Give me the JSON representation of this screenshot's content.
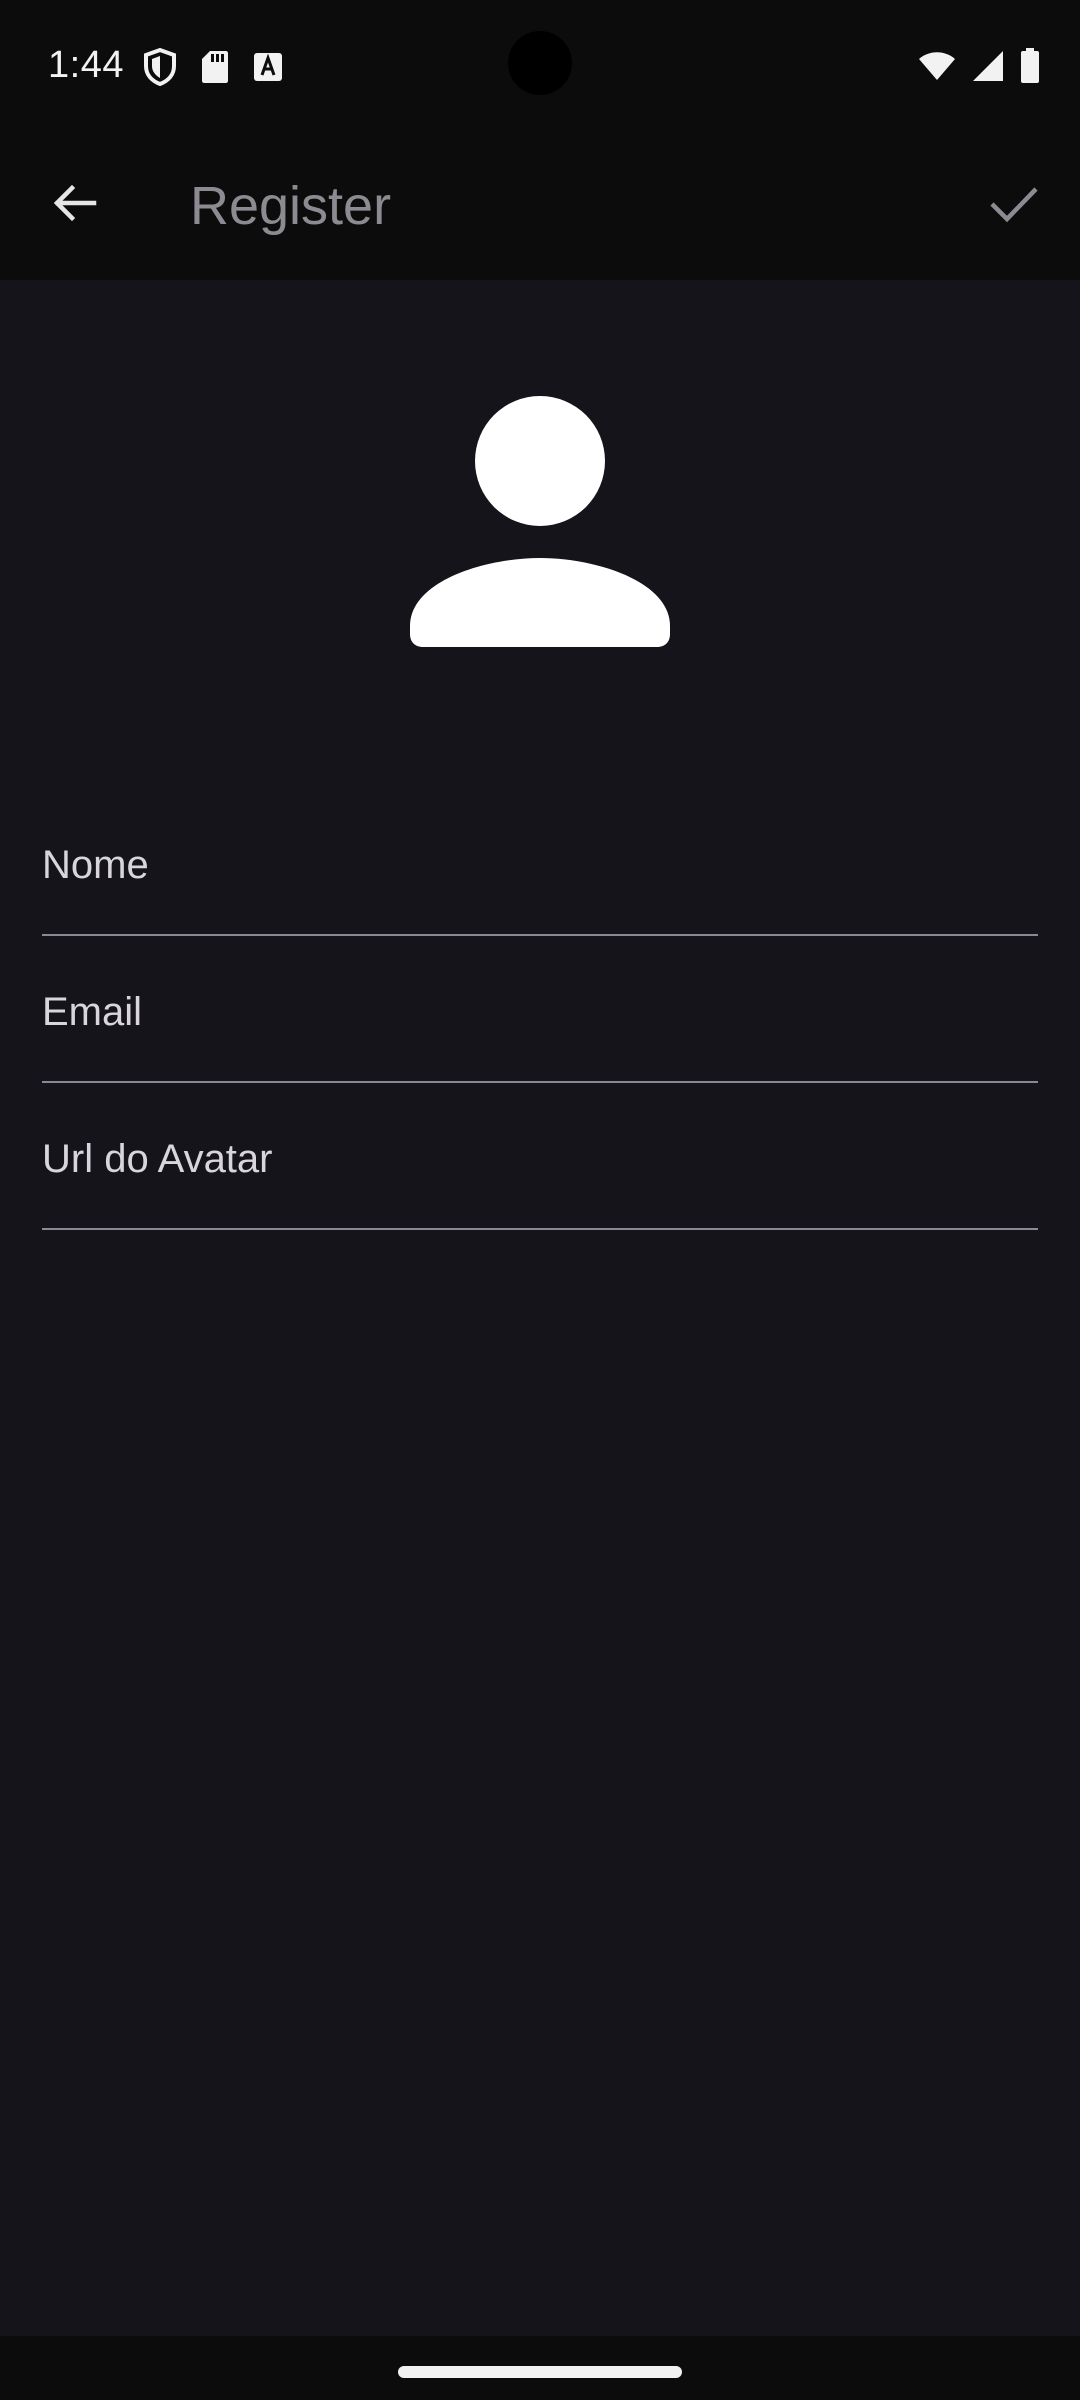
{
  "status_bar": {
    "time": "1:44",
    "left_icons": [
      "shield-icon",
      "sd-card-icon",
      "text-a-icon"
    ],
    "right_icons": [
      "wifi-icon",
      "signal-icon",
      "battery-icon"
    ]
  },
  "app_bar": {
    "title": "Register",
    "back_icon": "arrow-back-icon",
    "confirm_icon": "check-icon"
  },
  "avatar": {
    "icon": "person-icon"
  },
  "form": {
    "fields": [
      {
        "label": "Nome",
        "value": ""
      },
      {
        "label": "Email",
        "value": ""
      },
      {
        "label": "Url do Avatar",
        "value": ""
      }
    ]
  },
  "colors": {
    "background": "#16141b",
    "bar": "#0c0c0d",
    "title": "#8d8b91",
    "label": "#d8d6dc",
    "underline": "#8a8890"
  }
}
